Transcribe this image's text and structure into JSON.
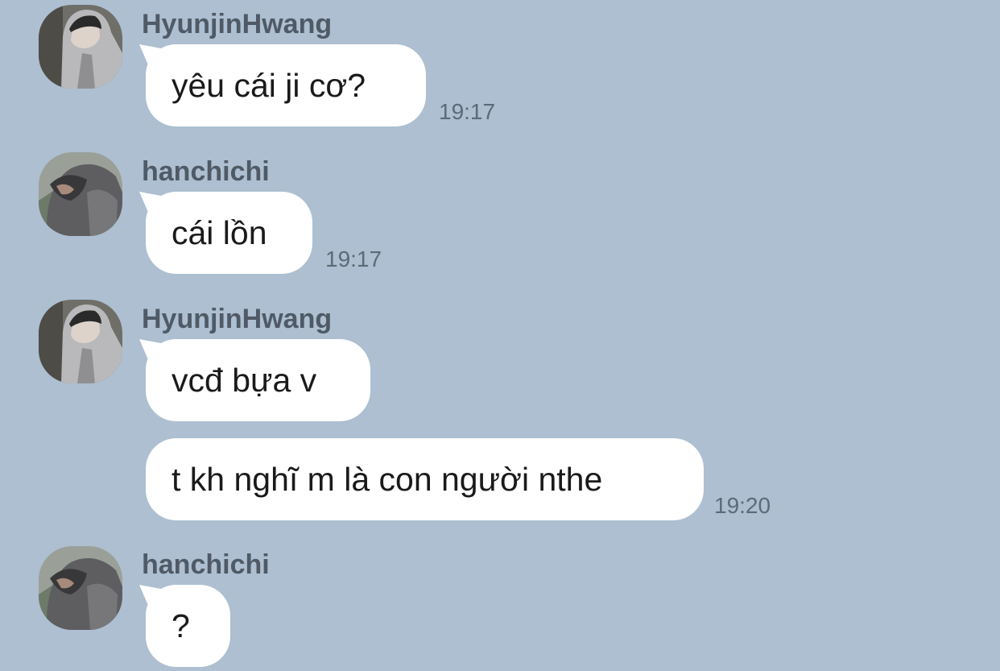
{
  "messages": [
    {
      "sender": "HyunjinHwang",
      "avatar_icon": "hooded-person-avatar",
      "bubbles": [
        {
          "text": "yêu cái ji cơ?",
          "time": "19:17"
        }
      ]
    },
    {
      "sender": "hanchichi",
      "avatar_icon": "hooded-person-avatar",
      "bubbles": [
        {
          "text": "cái lồn",
          "time": "19:17"
        }
      ]
    },
    {
      "sender": "HyunjinHwang",
      "avatar_icon": "hooded-person-avatar",
      "bubbles": [
        {
          "text": "vcđ bựa v",
          "time": ""
        },
        {
          "text": "t kh nghĩ m là con người nthe",
          "time": "19:20"
        }
      ]
    },
    {
      "sender": "hanchichi",
      "avatar_icon": "hooded-person-avatar",
      "bubbles": [
        {
          "text": "?",
          "time": ""
        }
      ]
    }
  ],
  "colors": {
    "background": "#adbfd0",
    "bubble": "#ffffff",
    "sender_text": "#4f5a66",
    "time_text": "#5d6a78"
  }
}
